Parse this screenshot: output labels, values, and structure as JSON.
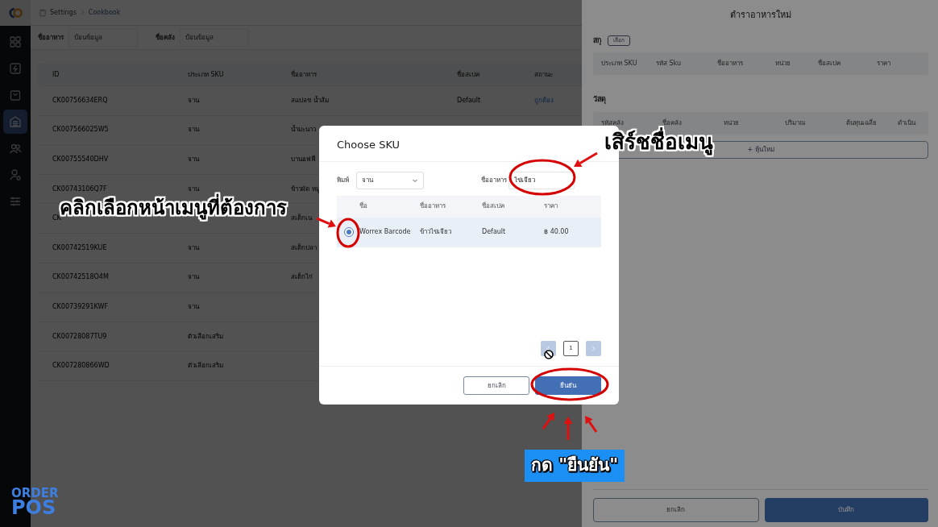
{
  "header": {
    "breadcrumb": [
      "Settings",
      "Cookbook"
    ]
  },
  "sidebar": {
    "items": [
      {
        "kind": "grid",
        "selected": false
      },
      {
        "kind": "bolt",
        "selected": false
      },
      {
        "kind": "bag",
        "selected": false
      },
      {
        "kind": "store",
        "selected": true
      },
      {
        "kind": "users",
        "selected": false
      },
      {
        "kind": "user",
        "selected": false
      },
      {
        "kind": "sliders",
        "selected": false
      }
    ]
  },
  "logo": {
    "line1": "ORDER",
    "line2": "POS"
  },
  "filters": [
    {
      "label": "ชื่ออาหาร",
      "placeholder": "ป้อนข้อมูล"
    },
    {
      "label": "ชื่อคลัง",
      "placeholder": "ป้อนข้อมูล"
    }
  ],
  "table": {
    "columns": [
      "ID",
      "ประเภท SKU",
      "ชื่ออาหาร",
      "ชื่อสเปค",
      "สถานะ"
    ],
    "rows": [
      {
        "id": "CK00756634ERQ",
        "sku_type": "จาน",
        "food": "สแปลช น้ำส้ม",
        "spec": "Default",
        "status": "ถูกต้อง"
      },
      {
        "id": "CK007566025W5",
        "sku_type": "จาน",
        "food": "น้ำมะนาว"
      },
      {
        "id": "CK00755540DHV",
        "sku_type": "จาน",
        "food": "บานอฟฟี่"
      },
      {
        "id": "CK00743106Q7F",
        "sku_type": "จาน",
        "food": "ข้าวผัด หมู"
      },
      {
        "id": "CK",
        "food": "สเต็กเน"
      },
      {
        "id": "CK00742519KUE",
        "sku_type": "จาน",
        "food": "สเต็กปลา"
      },
      {
        "id": "CK00742518O4M",
        "sku_type": "จาน",
        "food": "สเต็กไก่"
      },
      {
        "id": "CK00739291KWF",
        "sku_type": "จาน"
      },
      {
        "id": "CK00728087TU9",
        "sku_type": "ตัวเลือกเสริม"
      },
      {
        "id": "CK007280866WD",
        "sku_type": "ตัวเลือกเสริม"
      }
    ]
  },
  "drawer": {
    "title": "ตำราอาหารใหม่",
    "sku_label": "สกุ",
    "select_button": "เลือก",
    "sku_columns": [
      "ประเภท SKU",
      "รหัส Sku",
      "ชื่ออาหาร",
      "หน่วย",
      "ชื่อสเปค",
      "ราคา"
    ],
    "materials_label": "วัสดุ",
    "material_columns": [
      "รหัสคลัง",
      "ชื่อคลัง",
      "หน่วย",
      "ปริมาณ",
      "ต้นทุนเฉลี่ย",
      "ดำเนิน"
    ],
    "add_button": "+ หุ้นใหม่",
    "buttons": [
      {
        "label": "ยกเลิก",
        "kind": "outline"
      },
      {
        "label": "บันทึก",
        "kind": "primary"
      }
    ]
  },
  "modal": {
    "title": "Choose SKU",
    "type_label": "พิมพ์",
    "type_value": "จาน",
    "name_label": "ชื่ออาหาร",
    "name_value": "ไข่เจียว",
    "columns": [
      "ชื่อ",
      "ชื่ออาหาร",
      "ชื่อสเปค",
      "ราคา"
    ],
    "rows": [
      {
        "selected": true,
        "cells": [
          "Worrex Barcode",
          "ข้าวไข่เจียว",
          "Default",
          "฿ 40.00"
        ]
      }
    ],
    "pagination": {
      "prev_disabled": true,
      "next_disabled": true,
      "pages": [
        {
          "label": "1",
          "selected": true
        }
      ]
    },
    "buttons": [
      {
        "label": "ยกเลิก",
        "kind": "outline"
      },
      {
        "label": "ยืนยัน",
        "kind": "primary"
      }
    ]
  },
  "annotations": [
    {
      "kind": "callout",
      "text": "เสิร์ชชื่อเมนู"
    },
    {
      "kind": "callout",
      "text": "คลิกเลือกหน้าเมนูที่ต้องการ"
    },
    {
      "kind": "banner",
      "text": "กด \"ยืนยัน\""
    }
  ]
}
